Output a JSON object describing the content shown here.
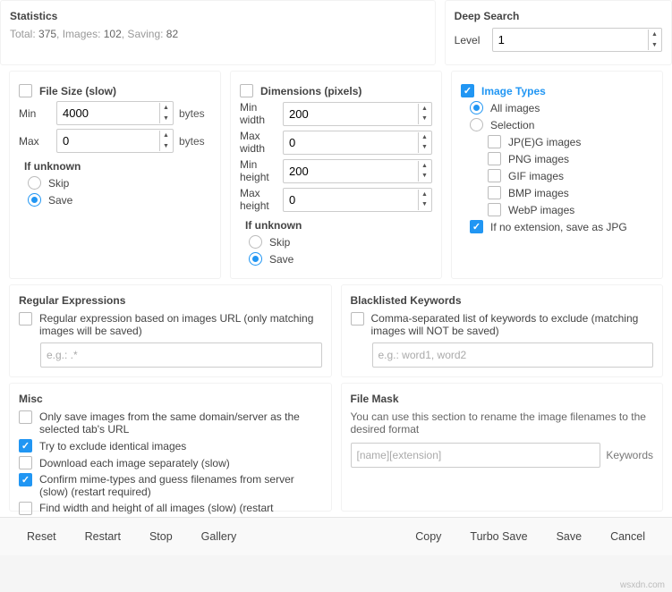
{
  "stats": {
    "title": "Statistics",
    "line_prefix": "Total: ",
    "total": "375",
    "images_prefix": ", Images: ",
    "images": "102",
    "saving_prefix": ", Saving: ",
    "saving": "82"
  },
  "deep": {
    "title": "Deep Search",
    "level_label": "Level",
    "level_value": "1"
  },
  "filesize": {
    "title": "File Size (slow)",
    "min_label": "Min",
    "min_value": "4000",
    "max_label": "Max",
    "max_value": "0",
    "unit": "bytes",
    "unknown_title": "If unknown",
    "skip": "Skip",
    "save": "Save"
  },
  "dims": {
    "title": "Dimensions (pixels)",
    "minw_label": "Min width",
    "minw_value": "200",
    "maxw_label": "Max width",
    "maxw_value": "0",
    "minh_label": "Min height",
    "minh_value": "200",
    "maxh_label": "Max height",
    "maxh_value": "0",
    "unknown_title": "If unknown",
    "skip": "Skip",
    "save": "Save"
  },
  "types": {
    "title": "Image Types",
    "all": "All images",
    "sel": "Selection",
    "jpeg": "JP(E)G images",
    "png": "PNG images",
    "gif": "GIF images",
    "bmp": "BMP images",
    "webp": "WebP images",
    "noext": "If no extension, save as JPG"
  },
  "regex": {
    "title": "Regular Expressions",
    "desc": "Regular expression based on images URL (only matching images will be saved)",
    "placeholder": "e.g.: .*"
  },
  "blacklist": {
    "title": "Blacklisted Keywords",
    "desc": "Comma-separated list of keywords to exclude (matching images will NOT be saved)",
    "placeholder": "e.g.: word1, word2"
  },
  "misc": {
    "title": "Misc",
    "same_domain": "Only save images from the same domain/server as the selected tab's URL",
    "exclude_identical": "Try to exclude identical images",
    "download_sep": "Download each image separately (slow)",
    "confirm_mime": "Confirm mime-types and guess filenames from server (slow) (restart required)",
    "find_dims": "Find width and height of all images (slow) (restart"
  },
  "mask": {
    "title": "File Mask",
    "desc": "You can use this section to rename the image filenames to the desired format",
    "placeholder": "[name][extension]",
    "keywords": "Keywords"
  },
  "footer": {
    "reset": "Reset",
    "restart": "Restart",
    "stop": "Stop",
    "gallery": "Gallery",
    "copy": "Copy",
    "turbo": "Turbo Save",
    "save": "Save",
    "cancel": "Cancel"
  },
  "watermark": "wsxdn.com"
}
